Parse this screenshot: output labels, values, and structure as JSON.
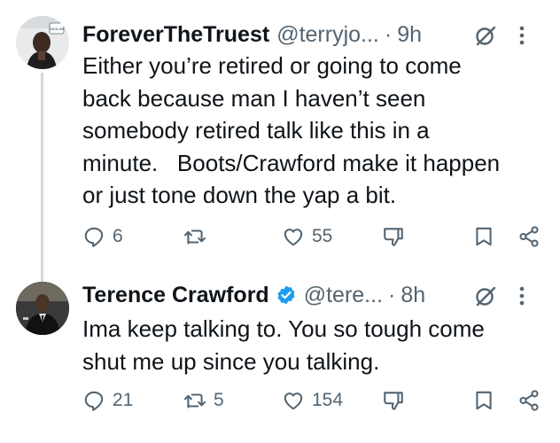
{
  "tweets": [
    {
      "name": "ForeverTheTruest",
      "handle": "@terryjo...",
      "dot": "·",
      "time": "9h",
      "text": "Either you’re retired or going to come\nback because man I haven’t seen\nsomebody retired talk like this in a\nminute.   Boots/Crawford make it happen\nor just tone down the yap a bit.",
      "replies": "6",
      "retweets": "",
      "likes": "55",
      "avatar_badge_text": "SAGLAB",
      "verified": false
    },
    {
      "name": "Terence Crawford",
      "handle": "@tere...",
      "dot": "·",
      "time": "8h",
      "text": "Ima keep talking to. You so tough come\nshut me up since you talking.",
      "replies": "21",
      "retweets": "5",
      "likes": "154",
      "verified": true
    }
  ],
  "icons": {
    "reply": "reply-icon",
    "retweet": "retweet-icon",
    "like": "heart-icon",
    "dislike": "thumbs-down-icon",
    "bookmark": "bookmark-icon",
    "share": "share-icon",
    "grok": "grok-icon",
    "more": "more-dots-icon",
    "verified": "verified-badge-icon"
  },
  "colors": {
    "text": "#0f1419",
    "secondary": "#536471",
    "verified": "#1d9bf0",
    "thread_line": "#cfd9de"
  }
}
